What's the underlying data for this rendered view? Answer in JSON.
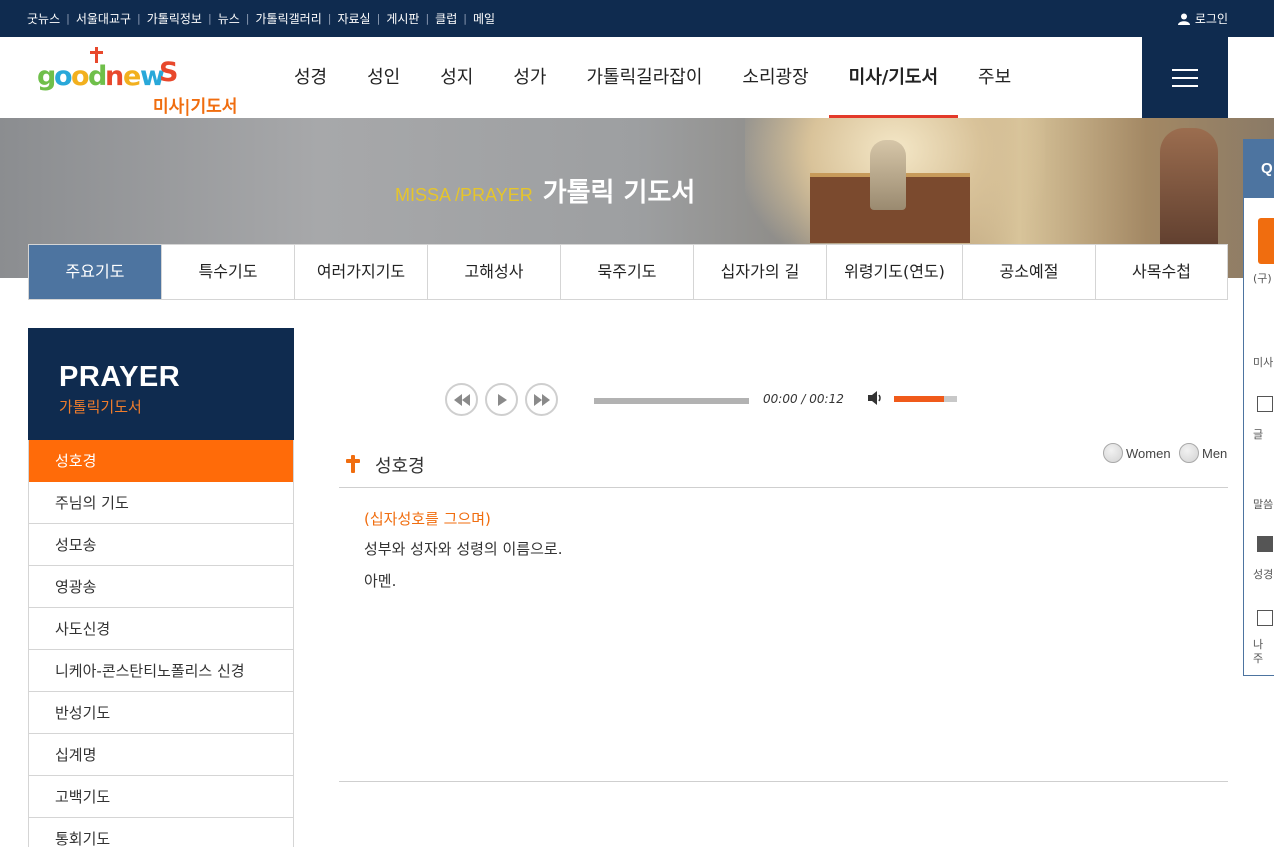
{
  "topbar": {
    "links": [
      "굿뉴스",
      "서울대교구",
      "가톨릭정보",
      "뉴스",
      "가톨릭갤러리",
      "자료실",
      "게시판",
      "클럽",
      "메일"
    ],
    "login": "로그인"
  },
  "header": {
    "logo_text": "goodnews",
    "logo_sub": "미사|기도서",
    "nav": [
      "성경",
      "성인",
      "성지",
      "성가",
      "가톨릭길라잡이",
      "소리광장",
      "미사/기도서",
      "주보"
    ],
    "active_nav": "미사/기도서",
    "menu_icon": "hamburger-icon"
  },
  "hero": {
    "title_en": "MISSA /PRAYER",
    "title_ko": "가톨릭 기도서"
  },
  "subtabs": [
    "주요기도",
    "특수기도",
    "여러가지기도",
    "고해성사",
    "묵주기도",
    "십자가의 길",
    "위령기도(연도)",
    "공소예절",
    "사목수첩"
  ],
  "active_subtab": "주요기도",
  "sidebar": {
    "title": "PRAYER",
    "subtitle": "가톨릭기도서",
    "items": [
      "성호경",
      "주님의 기도",
      "성모송",
      "영광송",
      "사도신경",
      "니케아-콘스탄티노폴리스 신경",
      "반성기도",
      "십계명",
      "고백기도",
      "통회기도"
    ],
    "active": "성호경"
  },
  "player": {
    "time": "00:00 / 00:12",
    "progress": 0,
    "volume": 0.8
  },
  "prayer": {
    "title": "성호경",
    "voice_women": "Women",
    "voice_men": "Men",
    "rubric": "(십자성호를 그으며)",
    "lines": [
      "성부와 성자와 성령의 이름으로.",
      "아멘."
    ]
  },
  "colors": {
    "navy": "#0f2b4f",
    "blue_tab": "#4d74a0",
    "orange": "#ff6b09",
    "nav_underline": "#e33a2a",
    "hero_title_en": "#e6c52b"
  },
  "quick_panel": {
    "head": "Q",
    "labels": [
      "(구)",
      "미사",
      "글",
      "말씀",
      "성경",
      "나",
      "주"
    ]
  }
}
